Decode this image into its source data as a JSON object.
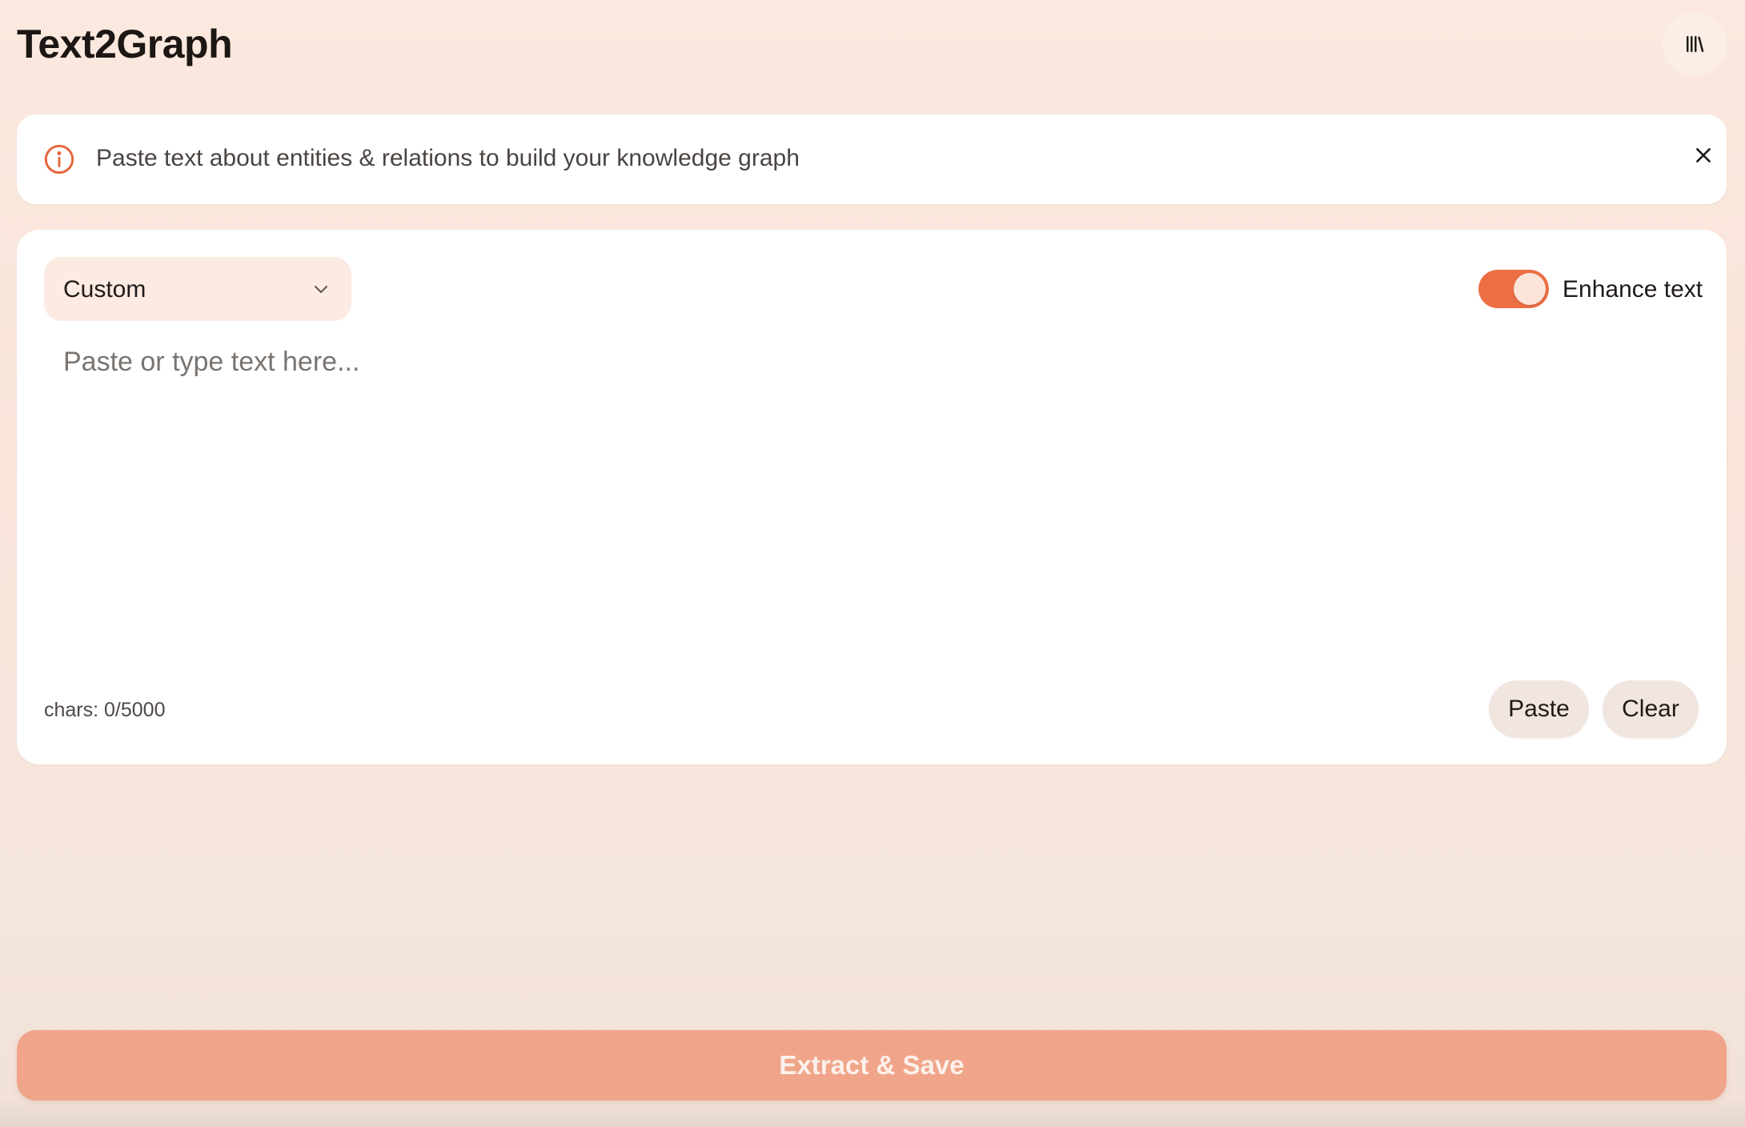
{
  "app": {
    "title": "Text2Graph"
  },
  "header": {
    "library_icon": "library-icon"
  },
  "banner": {
    "icon": "info-icon",
    "text": "Paste text about entities & relations to build your knowledge graph",
    "close_icon": "close-icon"
  },
  "editor": {
    "preset": {
      "selected": "Custom"
    },
    "enhance": {
      "label": "Enhance text",
      "enabled": true
    },
    "textarea": {
      "value": "",
      "placeholder": "Paste or type text here..."
    },
    "char_count": "chars: 0/5000",
    "paste_label": "Paste",
    "clear_label": "Clear"
  },
  "actions": {
    "extract_label": "Extract & Save"
  },
  "colors": {
    "accent": "#ec6e44",
    "extract_button": "#f0a58a",
    "background": "#fbe9df"
  }
}
